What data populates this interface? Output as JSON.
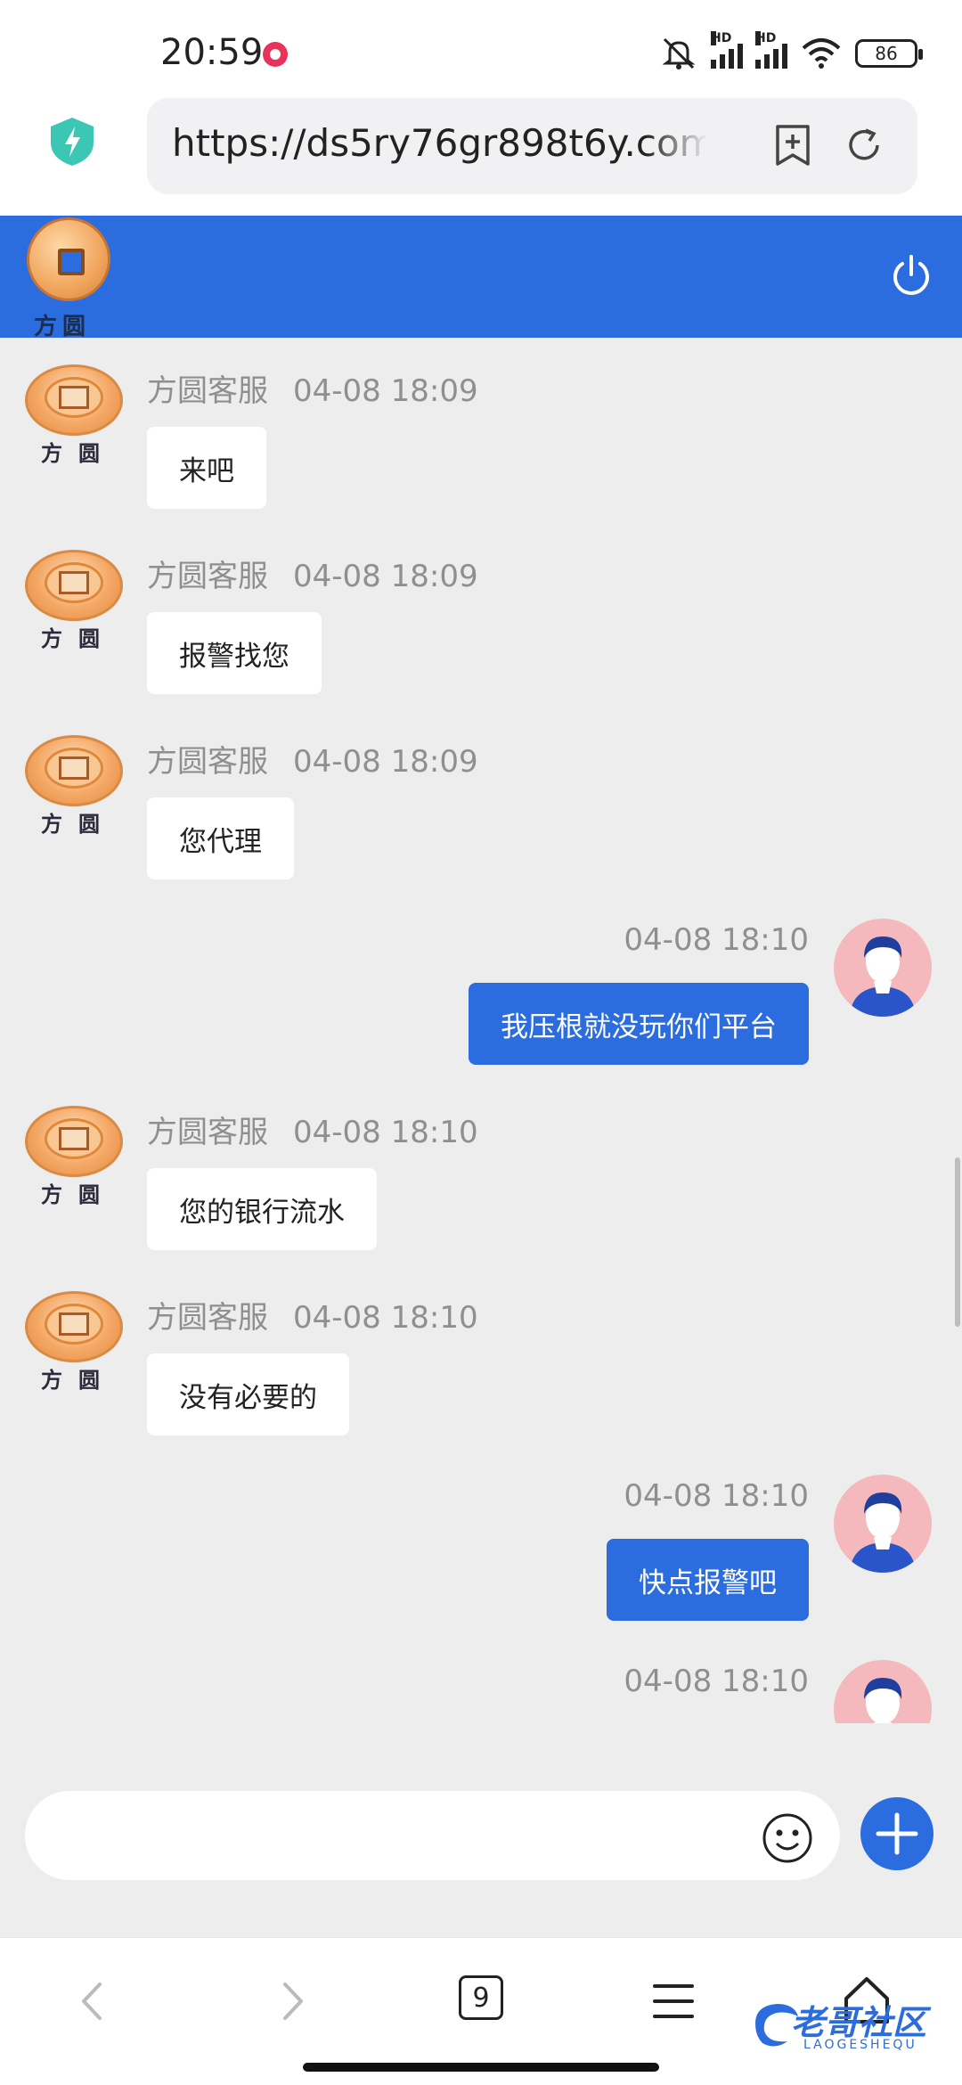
{
  "status_bar": {
    "time": "20:59",
    "battery": "86",
    "hd": "HD"
  },
  "browser": {
    "url": "https://ds5ry76gr898t6y.com",
    "tab_count": "9"
  },
  "app": {
    "logo_text": "方圆"
  },
  "messages": [
    {
      "side": "agent",
      "sender": "方圆客服",
      "time": "04-08 18:09",
      "text": "来吧"
    },
    {
      "side": "agent",
      "sender": "方圆客服",
      "time": "04-08 18:09",
      "text": "报警找您"
    },
    {
      "side": "agent",
      "sender": "方圆客服",
      "time": "04-08 18:09",
      "text": "您代理"
    },
    {
      "side": "me",
      "time": "04-08 18:10",
      "text": "我压根就没玩你们平台"
    },
    {
      "side": "agent",
      "sender": "方圆客服",
      "time": "04-08 18:10",
      "text": "您的银行流水"
    },
    {
      "side": "agent",
      "sender": "方圆客服",
      "time": "04-08 18:10",
      "text": "没有必要的"
    },
    {
      "side": "me",
      "time": "04-08 18:10",
      "text": "快点报警吧"
    },
    {
      "side": "me",
      "time": "04-08 18:10",
      "text": ""
    }
  ],
  "input": {
    "placeholder": ""
  },
  "watermark": {
    "text": "老哥社区",
    "sub": "LAOGESHEQU"
  },
  "colors": {
    "primary": "#2b6ddf",
    "chat_bg": "#ededed",
    "user_avatar_bg": "#f4b8bd"
  }
}
